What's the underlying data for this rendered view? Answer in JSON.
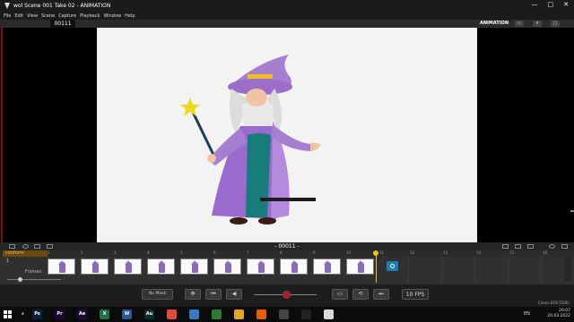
{
  "window": {
    "title": "wol  Scene 001  Take 02 - ANIMATION",
    "controls": [
      "—",
      "□",
      "✕"
    ]
  },
  "menu": [
    "File",
    "Edit",
    "View",
    "Scene",
    "Capture",
    "Playback",
    "Window",
    "Help"
  ],
  "toolbar": {
    "frame_counter": "00111",
    "mode_label": "ANIMATION"
  },
  "viewer": {
    "frame_indicator": "- 00011 -"
  },
  "timeline": {
    "layer_name": "conform",
    "layer_number": "1",
    "frames_label": "Frames",
    "ruler_ticks": [
      "1",
      "2",
      "3",
      "4",
      "5",
      "6",
      "7",
      "8",
      "9",
      "10",
      "11",
      "12",
      "13",
      "14",
      "15",
      "16"
    ],
    "thumbnail_count": 10
  },
  "playback": {
    "mask_label": "No Mask",
    "fps_label": "10 FPS"
  },
  "taskbar": {
    "apps": [
      {
        "icon": "windows-start-icon"
      },
      {
        "icon": "search-icon"
      },
      {
        "icon": "photoshop-icon",
        "label": "Ps",
        "color": "#0c1f3c"
      },
      {
        "icon": "premiere-icon",
        "label": "Pr",
        "color": "#1f0a33"
      },
      {
        "icon": "after-effects-icon",
        "label": "Ae",
        "color": "#1d0c35"
      },
      {
        "icon": "excel-icon",
        "label": "X",
        "color": "#1e7145"
      },
      {
        "icon": "word-icon",
        "label": "W",
        "color": "#2b579a"
      },
      {
        "icon": "audition-icon",
        "label": "Au",
        "color": "#0b2e2a"
      },
      {
        "icon": "chrome-icon",
        "label": "",
        "color": "#dd4b39"
      },
      {
        "icon": "paint-icon",
        "label": "",
        "color": "#3b78c4"
      },
      {
        "icon": "green-app-icon",
        "label": "",
        "color": "#2e7d32"
      },
      {
        "icon": "folder-icon",
        "label": "",
        "color": "#e0a526"
      },
      {
        "icon": "firefox-icon",
        "label": "",
        "color": "#e66000"
      },
      {
        "icon": "app-icon",
        "label": "",
        "color": "#444444"
      },
      {
        "icon": "camera-app-icon",
        "label": "",
        "color": "#222222"
      },
      {
        "icon": "dragonframe-icon",
        "label": "",
        "color": "#d9d9d9"
      }
    ],
    "language": "EN",
    "time": "20:07",
    "date": "20.03.2022"
  },
  "watermark": "Canon EOS 550D",
  "colors": {
    "accent": "#f0c020",
    "record": "#c0151c",
    "camera": "#1e7fb0"
  }
}
